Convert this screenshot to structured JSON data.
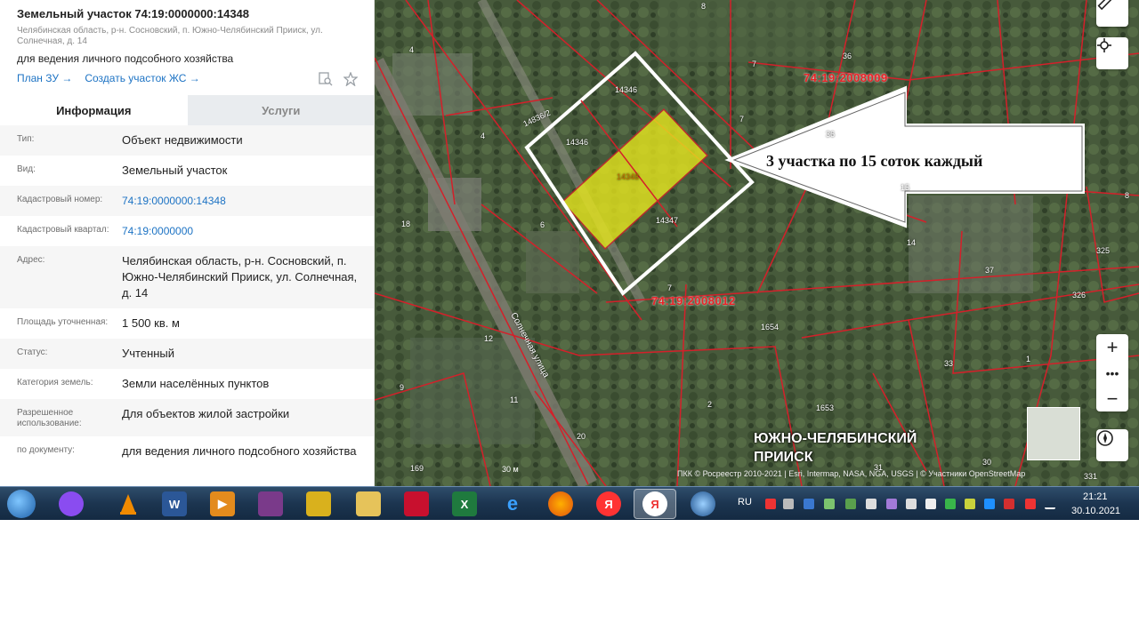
{
  "panel": {
    "title": "Земельный участок 74:19:0000000:14348",
    "address_line": "Челябинская область, р-н. Сосновский, п. Южно-Челябинский Прииск, ул. Солнечная, д. 14",
    "purpose": "для ведения личного подсобного хозяйства",
    "links": [
      "План ЗУ →",
      "Создать участок ЖС →"
    ],
    "tabs": [
      "Информация",
      "Услуги"
    ],
    "rows": [
      {
        "key": "Тип:",
        "value": "Объект недвижимости",
        "link": false
      },
      {
        "key": "Вид:",
        "value": "Земельный участок",
        "link": false
      },
      {
        "key": "Кадастровый номер:",
        "value": "74:19:0000000:14348",
        "link": true
      },
      {
        "key": "Кадастровый квартал:",
        "value": "74:19:0000000",
        "link": true
      },
      {
        "key": "Адрес:",
        "value": "Челябинская область, р-н. Сосновский, п. Южно-Челябинский Прииск, ул. Солнечная, д. 14",
        "link": false
      },
      {
        "key": "Площадь уточненная:",
        "value": "1 500 кв. м",
        "link": false
      },
      {
        "key": "Статус:",
        "value": "Учтенный",
        "link": false
      },
      {
        "key": "Категория земель:",
        "value": "Земли населённых пунктов",
        "link": false
      },
      {
        "key": "Разрешенное использование:",
        "value": "Для объектов жилой застройки",
        "link": false
      },
      {
        "key": "по документу:",
        "value": "для ведения личного подсобного хозяйства",
        "link": false
      }
    ]
  },
  "map": {
    "annotation": "3 участка по 15 соток каждый",
    "place_name_1": "ЮЖНО-ЧЕЛЯБИНСКИЙ",
    "place_name_2": "ПРИИСК",
    "street": "Солнечная улица",
    "cad_quarters": [
      "74:19:2008009",
      "74:19:2008012"
    ],
    "parcel_labels": [
      "14348",
      "14346",
      "14347",
      "14346",
      "14836/2"
    ],
    "house_numbers": [
      "8",
      "4",
      "7",
      "36",
      "4",
      "7",
      "36",
      "18",
      "6",
      "15",
      "14",
      "37",
      "8",
      "325",
      "326",
      "7",
      "12",
      "1654",
      "33",
      "1",
      "9",
      "11",
      "2",
      "1653",
      "20",
      "169",
      "31",
      "30",
      "331"
    ],
    "scale": "30 м",
    "attribution": "ПКК © Росреестр 2010-2021 | Esri, Intermap, NASA, NGA, USGS | © Участники OpenStreetMap"
  },
  "taskbar": {
    "lang": "RU",
    "time": "21:21",
    "date": "30.10.2021",
    "yandex_label": "Я"
  },
  "colors": {
    "link": "#1d73c4",
    "cadastre_border": "#d4202a",
    "highlight": "#e6e61e"
  }
}
